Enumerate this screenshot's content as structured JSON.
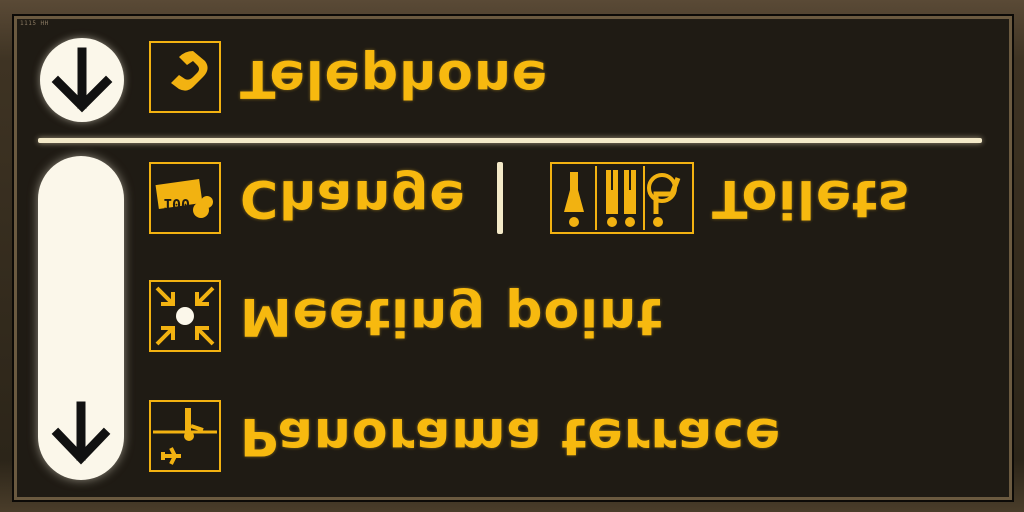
{
  "sign": {
    "corner_mark": "1115 HH",
    "rows": [
      {
        "id": "telephone",
        "label": "Telephone",
        "icon": "telephone-icon"
      },
      {
        "id": "change",
        "label": "Change",
        "icon": "currency-notes-icon",
        "icon_text": "100"
      },
      {
        "id": "toilets",
        "label": "Toilets",
        "icon": "toilets-icon"
      },
      {
        "id": "meeting",
        "label": "Meeting point",
        "icon": "meeting-point-icon"
      },
      {
        "id": "panorama",
        "label": "Panorama terrace",
        "icon": "panorama-terrace-icon"
      }
    ],
    "arrows": [
      "down-arrow-icon",
      "down-arrow-icon"
    ],
    "colors": {
      "text": "#f7b90f",
      "panel": "#1f1b14",
      "light": "#fbf7ea"
    }
  }
}
